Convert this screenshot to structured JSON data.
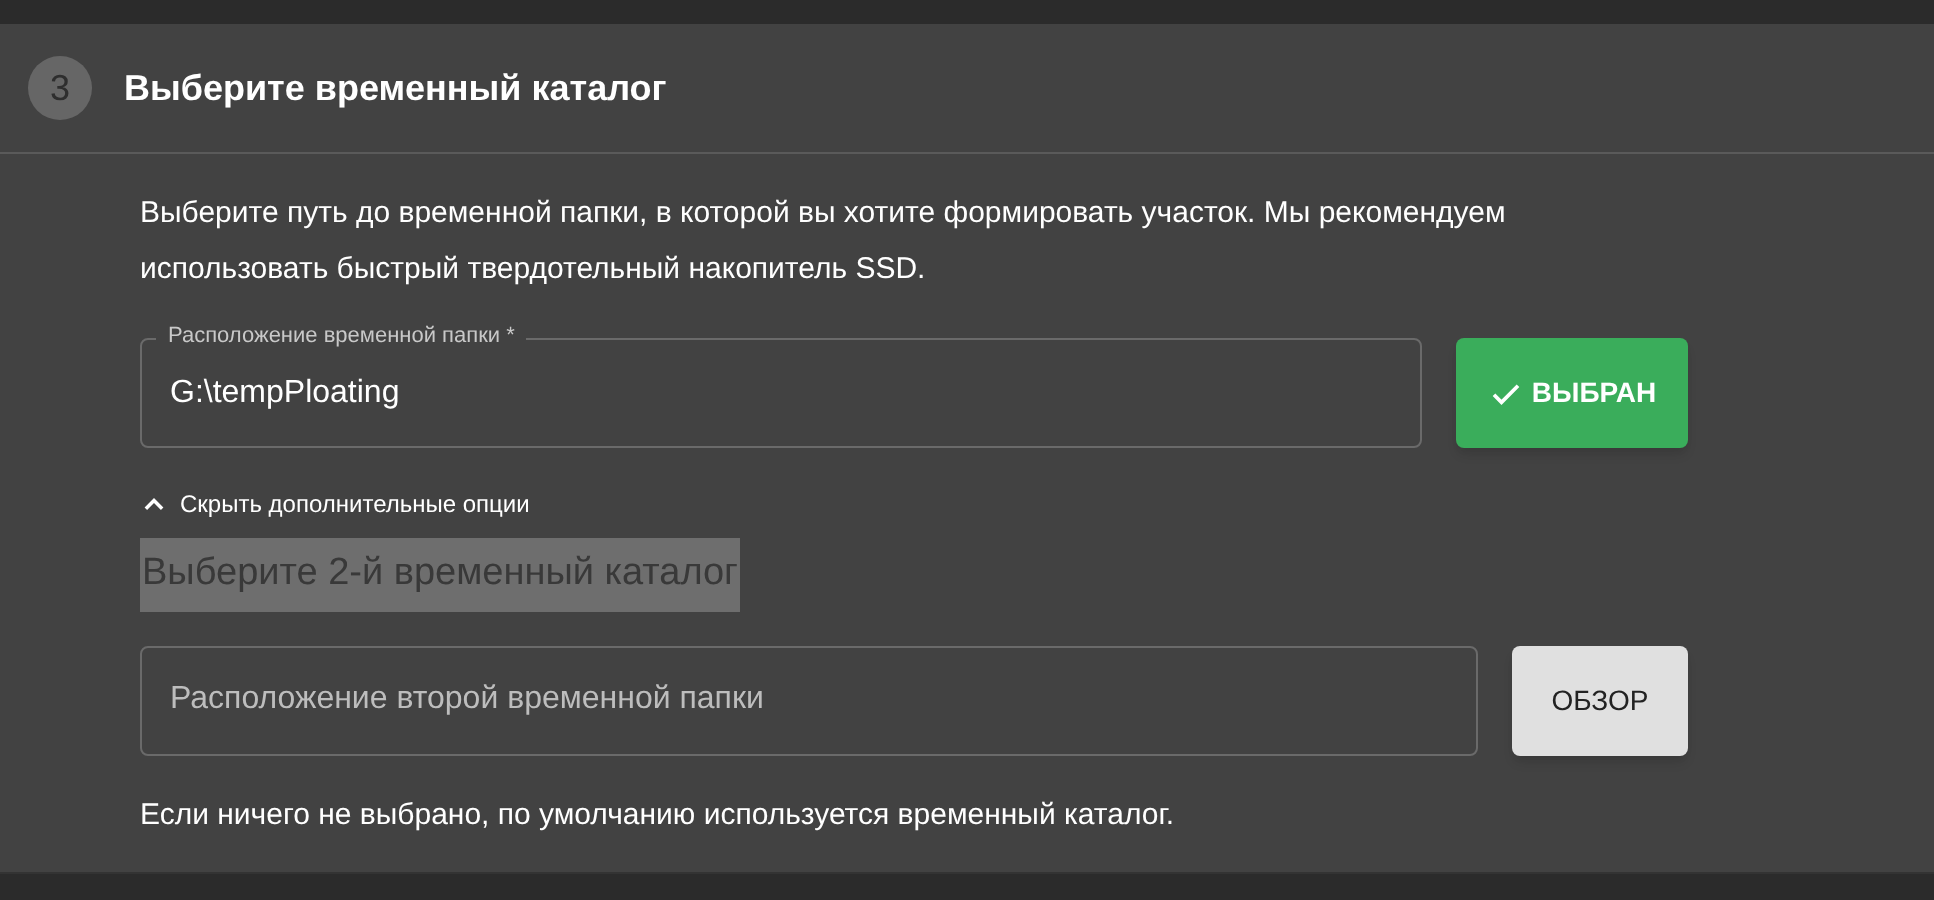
{
  "step": {
    "number": "3",
    "title": "Выберите временный каталог"
  },
  "description": "Выберите путь до временной папки, в которой вы хотите формировать участок. Мы рекомендуем использовать быстрый твердотельный накопитель SSD.",
  "primary_folder": {
    "label": "Расположение временной папки *",
    "value": "G:\\tempPloating",
    "button": {
      "label": "ВЫБРАН",
      "selected": true
    }
  },
  "options_toggle": {
    "label": "Скрыть дополнительные опции",
    "expanded": true
  },
  "second_folder": {
    "heading": "Выберите 2-й временный каталог",
    "placeholder": "Расположение второй временной папки",
    "button": {
      "label": "ОБЗОР",
      "selected": false
    }
  },
  "footnote": "Если ничего не выбрано, по умолчанию используется временный каталог."
}
